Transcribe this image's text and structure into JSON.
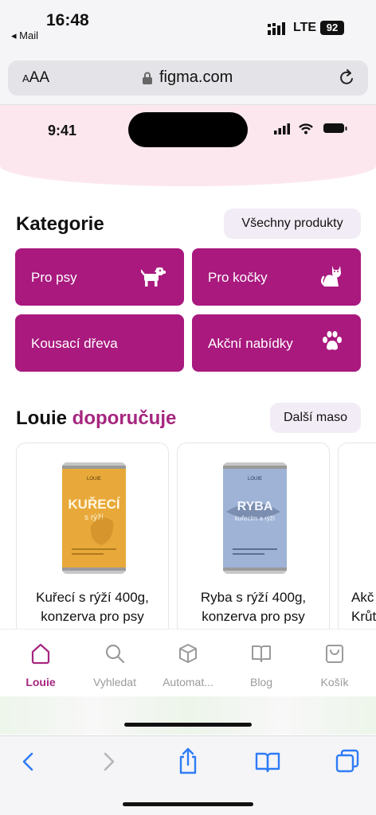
{
  "status_bar": {
    "time": "16:48",
    "back_app": "◂ Mail",
    "network": "LTE",
    "battery": "92"
  },
  "browser": {
    "text_size": "AA",
    "url": "figma.com",
    "reload_icon": "reload-icon"
  },
  "inner_phone": {
    "time": "9:41"
  },
  "categories": {
    "title": "Kategorie",
    "all_button": "Všechny produkty",
    "tiles": [
      {
        "label": "Pro psy",
        "icon": "dog-icon"
      },
      {
        "label": "Pro kočky",
        "icon": "cat-icon"
      },
      {
        "label": "Kousací dřeva",
        "icon": ""
      },
      {
        "label": "Akční nabídky",
        "icon": "paw-icon"
      }
    ]
  },
  "recommend": {
    "title_plain": "Louie",
    "title_accent": "doporučuje",
    "more_button": "Další maso",
    "products": [
      {
        "name": "Kuřecí s rýží 400g, konzerva pro psy",
        "line1": "Kuřecí s rýží 400g,",
        "line2": "konzerva pro psy",
        "can_label_top": "KUŘECÍ",
        "can_label_bottom": "s rýží",
        "can_color": "#e8a93a"
      },
      {
        "name": "Ryba s rýží 400g, konzerva pro psy",
        "line1": "Ryba s rýží 400g,",
        "line2": "konzerva pro psy",
        "can_label_top": "RYBA",
        "can_label_bottom": "kuřecím a rýží",
        "can_color": "#9fb3d6"
      },
      {
        "name": "Akč... Krůt...",
        "line1": "Akč",
        "line2": "Krůt"
      }
    ]
  },
  "tabs": [
    {
      "label": "Louie",
      "icon": "home-icon",
      "active": true
    },
    {
      "label": "Vyhledat",
      "icon": "search-icon",
      "active": false
    },
    {
      "label": "Automat...",
      "icon": "box-icon",
      "active": false
    },
    {
      "label": "Blog",
      "icon": "book-icon",
      "active": false
    },
    {
      "label": "Košík",
      "icon": "bag-icon",
      "active": false
    }
  ],
  "colors": {
    "brand": "#a9197e",
    "accent_text": "#a6267f",
    "pill_bg": "#f2ecf6",
    "header_pink": "#fde7ef",
    "safari_blue": "#2f7cf6"
  }
}
